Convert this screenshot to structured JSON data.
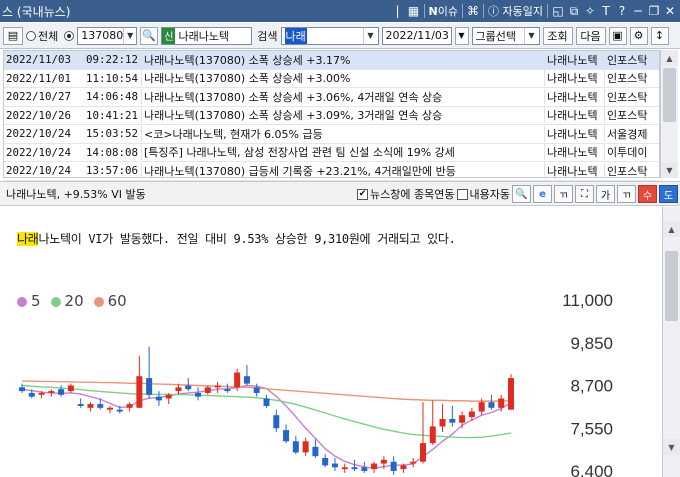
{
  "window": {
    "title": "스 (국내뉴스)",
    "issue_label": "이슈",
    "autolog_label": "자동일지",
    "font_label": "T",
    "help_label": "?"
  },
  "toolbar": {
    "radio_all_label": "전체",
    "stock_code": "137080",
    "badge": "신",
    "stock_name": "나래나노텍",
    "search_label": "검색",
    "search_value": "나래",
    "date_value": "2022/11/03",
    "group_select": "그룹선택",
    "query_button": "조회",
    "next_button": "다음"
  },
  "news": [
    {
      "date": "2022/11/03",
      "time": "09:22:12",
      "title": "나래나노텍(137080) 소폭 상승세 +3.17%",
      "code": "나래나노텍",
      "source": "인포스탁"
    },
    {
      "date": "2022/11/01",
      "time": "11:10:54",
      "title": "나래나노텍(137080) 소폭 상승세 +3.00%",
      "code": "나래나노텍",
      "source": "인포스탁"
    },
    {
      "date": "2022/10/27",
      "time": "14:06:48",
      "title": "나래나노텍(137080) 소폭 상승세 +3.06%, 4거래일 연속 상승",
      "code": "나래나노텍",
      "source": "인포스탁"
    },
    {
      "date": "2022/10/26",
      "time": "10:41:21",
      "title": "나래나노텍(137080) 소폭 상승세 +3.09%, 3거래일 연속 상승",
      "code": "나래나노텍",
      "source": "인포스탁"
    },
    {
      "date": "2022/10/24",
      "time": "15:03:52",
      "title": "<코>나래나노텍, 현재가 6.05% 급등",
      "code": "나래나노텍",
      "source": "서울경제"
    },
    {
      "date": "2022/10/24",
      "time": "14:08:08",
      "title": "[특징주] 나래나노텍, 삼성 전장사업 관련 팀 신설 소식에 19% 강세",
      "code": "나래나노텍",
      "source": "이투데이"
    },
    {
      "date": "2022/10/24",
      "time": "13:57:06",
      "title": "나래나노텍(137080) 급등세 기록중 +23.21%, 4거래일만에 반등",
      "code": "나래나노텍",
      "source": "인포스탁"
    }
  ],
  "detail": {
    "title": "나래나노텍, +9.53% VI 발동",
    "link_news_label": "뉴스창에 종목연동",
    "auto_content_label": "내용자동",
    "up_button": "수",
    "down_button": "도",
    "highlight": "나래",
    "body_rest": "나노텍이 VI가 발동했다. 전일 대비 9.53% 상승한 9,310원에 거래되고 있다."
  },
  "chart_data": {
    "type": "candlestick",
    "legend": [
      {
        "name": "5",
        "color": "#c77fd6"
      },
      {
        "name": "20",
        "color": "#7fcf8a"
      },
      {
        "name": "60",
        "color": "#e8967a"
      }
    ],
    "y_ticks": [
      "11,000",
      "9,850",
      "8,700",
      "7,550",
      "6,400"
    ],
    "ylim": [
      6400,
      11000
    ],
    "candles": [
      {
        "o": 8650,
        "h": 8750,
        "l": 8500,
        "c": 8550
      },
      {
        "o": 8500,
        "h": 8600,
        "l": 8350,
        "c": 8400
      },
      {
        "o": 8450,
        "h": 8550,
        "l": 8350,
        "c": 8500
      },
      {
        "o": 8500,
        "h": 8600,
        "l": 8400,
        "c": 8550
      },
      {
        "o": 8600,
        "h": 8700,
        "l": 8400,
        "c": 8450
      },
      {
        "o": 8550,
        "h": 8750,
        "l": 8500,
        "c": 8700
      },
      {
        "o": 8200,
        "h": 8350,
        "l": 8100,
        "c": 8150
      },
      {
        "o": 8100,
        "h": 8250,
        "l": 8000,
        "c": 8200
      },
      {
        "o": 8200,
        "h": 8350,
        "l": 8050,
        "c": 8100
      },
      {
        "o": 8050,
        "h": 8150,
        "l": 7950,
        "c": 8100
      },
      {
        "o": 8050,
        "h": 8150,
        "l": 7950,
        "c": 8000
      },
      {
        "o": 8100,
        "h": 8250,
        "l": 8000,
        "c": 8200
      },
      {
        "o": 8100,
        "h": 9500,
        "l": 8100,
        "c": 8950
      },
      {
        "o": 8900,
        "h": 9750,
        "l": 8350,
        "c": 8450
      },
      {
        "o": 8400,
        "h": 8550,
        "l": 8150,
        "c": 8300
      },
      {
        "o": 8350,
        "h": 8500,
        "l": 8200,
        "c": 8450
      },
      {
        "o": 8550,
        "h": 8750,
        "l": 8450,
        "c": 8650
      },
      {
        "o": 8700,
        "h": 8900,
        "l": 8550,
        "c": 8600
      },
      {
        "o": 8500,
        "h": 8650,
        "l": 8300,
        "c": 8400
      },
      {
        "o": 8500,
        "h": 8700,
        "l": 8450,
        "c": 8650
      },
      {
        "o": 8650,
        "h": 8800,
        "l": 8500,
        "c": 8700
      },
      {
        "o": 8600,
        "h": 8750,
        "l": 8500,
        "c": 8550
      },
      {
        "o": 8650,
        "h": 9150,
        "l": 8550,
        "c": 9050
      },
      {
        "o": 8950,
        "h": 9250,
        "l": 8700,
        "c": 8750
      },
      {
        "o": 8650,
        "h": 8750,
        "l": 8400,
        "c": 8500
      },
      {
        "o": 8350,
        "h": 8450,
        "l": 8100,
        "c": 8150
      },
      {
        "o": 7900,
        "h": 8050,
        "l": 7450,
        "c": 7550
      },
      {
        "o": 7500,
        "h": 7650,
        "l": 7150,
        "c": 7200
      },
      {
        "o": 7200,
        "h": 7350,
        "l": 6850,
        "c": 6900
      },
      {
        "o": 6900,
        "h": 7300,
        "l": 6800,
        "c": 7200
      },
      {
        "o": 7050,
        "h": 7250,
        "l": 6750,
        "c": 6800
      },
      {
        "o": 6750,
        "h": 6850,
        "l": 6500,
        "c": 6550
      },
      {
        "o": 6600,
        "h": 6750,
        "l": 6400,
        "c": 6500
      },
      {
        "o": 6450,
        "h": 6600,
        "l": 6350,
        "c": 6500
      },
      {
        "o": 6500,
        "h": 6700,
        "l": 6400,
        "c": 6450
      },
      {
        "o": 6500,
        "h": 6650,
        "l": 6350,
        "c": 6400
      },
      {
        "o": 6450,
        "h": 6650,
        "l": 6350,
        "c": 6600
      },
      {
        "o": 6600,
        "h": 6800,
        "l": 6450,
        "c": 6700
      },
      {
        "o": 6650,
        "h": 6800,
        "l": 6300,
        "c": 6400
      },
      {
        "o": 6450,
        "h": 6600,
        "l": 6350,
        "c": 6550
      },
      {
        "o": 6600,
        "h": 6750,
        "l": 6500,
        "c": 6650
      },
      {
        "o": 6650,
        "h": 8250,
        "l": 6600,
        "c": 7150
      },
      {
        "o": 7150,
        "h": 8300,
        "l": 7100,
        "c": 7600
      },
      {
        "o": 7600,
        "h": 8200,
        "l": 7450,
        "c": 7800
      },
      {
        "o": 7800,
        "h": 8150,
        "l": 7600,
        "c": 7700
      },
      {
        "o": 7700,
        "h": 8000,
        "l": 7550,
        "c": 7900
      },
      {
        "o": 7850,
        "h": 8100,
        "l": 7750,
        "c": 8000
      },
      {
        "o": 8000,
        "h": 8350,
        "l": 7900,
        "c": 8250
      },
      {
        "o": 8250,
        "h": 8450,
        "l": 8050,
        "c": 8100
      },
      {
        "o": 8100,
        "h": 8450,
        "l": 8000,
        "c": 8350
      },
      {
        "o": 8050,
        "h": 9000,
        "l": 8050,
        "c": 8900
      }
    ],
    "ma": {
      "5": [
        8600,
        8560,
        8520,
        8500,
        8490,
        8500,
        8470,
        8400,
        8330,
        8220,
        8110,
        8130,
        8290,
        8360,
        8380,
        8420,
        8470,
        8500,
        8520,
        8560,
        8600,
        8610,
        8640,
        8700,
        8680,
        8620,
        8410,
        8150,
        7860,
        7550,
        7280,
        7000,
        6800,
        6660,
        6570,
        6510,
        6470,
        6520,
        6560,
        6560,
        6590,
        6790,
        6980,
        7200,
        7390,
        7630,
        7770,
        7900,
        7970,
        8080,
        8230
      ],
      "20": [
        8700,
        8680,
        8660,
        8650,
        8630,
        8610,
        8590,
        8560,
        8540,
        8520,
        8500,
        8480,
        8470,
        8460,
        8460,
        8460,
        8460,
        8450,
        8440,
        8430,
        8420,
        8410,
        8400,
        8390,
        8370,
        8340,
        8300,
        8250,
        8190,
        8120,
        8040,
        7960,
        7880,
        7800,
        7730,
        7660,
        7590,
        7520,
        7470,
        7420,
        7380,
        7360,
        7340,
        7330,
        7310,
        7300,
        7300,
        7310,
        7340,
        7380,
        7420
      ],
      "60": [
        8820,
        8820,
        8810,
        8810,
        8800,
        8800,
        8790,
        8790,
        8780,
        8780,
        8770,
        8760,
        8760,
        8750,
        8740,
        8730,
        8720,
        8710,
        8700,
        8690,
        8680,
        8670,
        8660,
        8650,
        8630,
        8610,
        8590,
        8570,
        8550,
        8530,
        8510,
        8490,
        8470,
        8450,
        8430,
        8410,
        8390,
        8370,
        8350,
        8330,
        8320,
        8310,
        8300,
        8300,
        8290,
        8290,
        8280,
        8280,
        8280,
        8280,
        8290
      ]
    }
  }
}
